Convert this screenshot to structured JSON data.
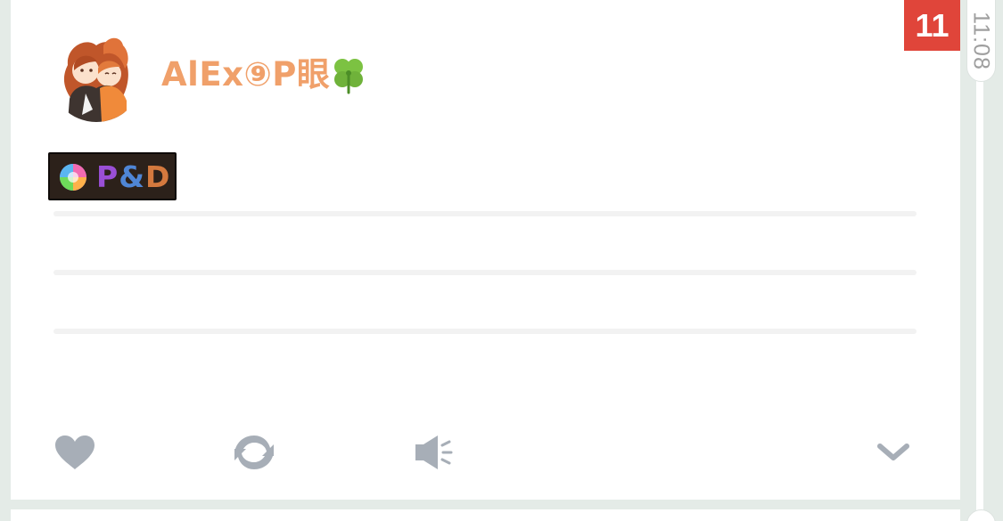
{
  "post": {
    "username": "AlEx⑨P眼",
    "username_emoji": "clover-icon",
    "badge": {
      "letters": [
        "P",
        "&",
        "D"
      ],
      "colors": [
        "#9a4fd6",
        "#4f86d6",
        "#d4793e"
      ]
    },
    "notification_count": "11",
    "time": "11:08"
  },
  "actions": {
    "like": "heart-icon",
    "repost": "repost-icon",
    "speak": "speaker-icon",
    "more": "chevron-down-icon"
  },
  "colors": {
    "username": "#f0a06a",
    "notification": "#e0453a",
    "icon": "#a7aeb7",
    "background": "#e4ebe7"
  }
}
